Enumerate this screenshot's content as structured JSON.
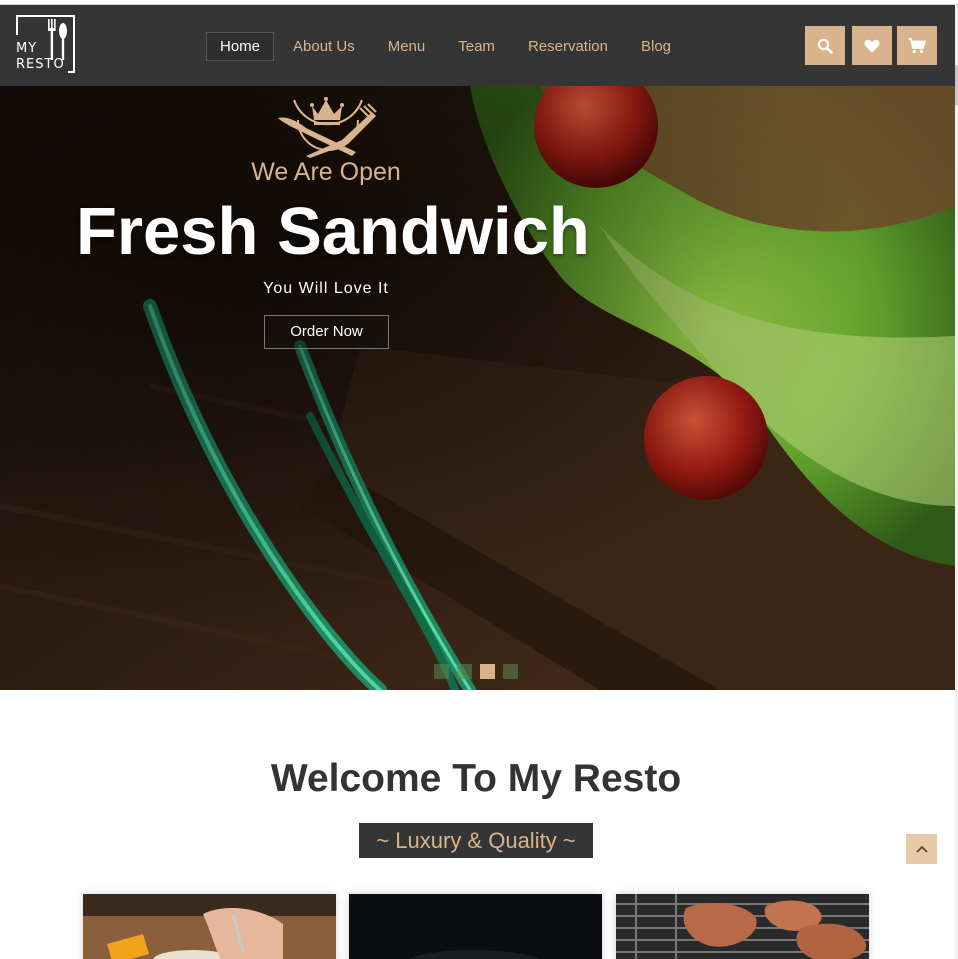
{
  "logo": {
    "line1": "MY",
    "line2": "RESTO"
  },
  "nav": {
    "items": [
      {
        "label": "Home",
        "active": true
      },
      {
        "label": "About Us"
      },
      {
        "label": "Menu"
      },
      {
        "label": "Team"
      },
      {
        "label": "Reservation"
      },
      {
        "label": "Blog"
      }
    ]
  },
  "header_icons": [
    "search-icon",
    "heart-icon",
    "cart-icon"
  ],
  "hero": {
    "kicker": "We Are Open",
    "headline": "Fresh Sandwich",
    "subheading": "You Will Love It",
    "cta": "Order Now",
    "slide_count": 4,
    "active_slide": 3
  },
  "welcome": {
    "title": "Welcome To My Resto",
    "tagline": "~ Luxury & Quality ~"
  },
  "colors": {
    "accent": "#d9b38c",
    "header_bg": "#353535",
    "text_dark": "#333333"
  }
}
